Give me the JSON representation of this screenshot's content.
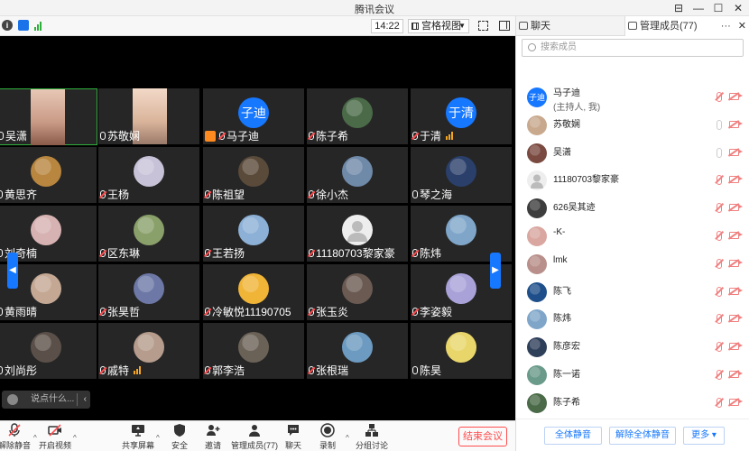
{
  "app": {
    "title": "腾讯会议"
  },
  "window_controls": {
    "pin": "⊟",
    "minimize": "—",
    "maximize": "☐",
    "close": "✕"
  },
  "toolbar": {
    "time": "14:22",
    "view": "宫格视图"
  },
  "tiles": [
    {
      "name": "吴潇",
      "avatar": "photo",
      "muted": false,
      "active": true
    },
    {
      "name": "苏敬娴",
      "avatar": "photo",
      "muted": false
    },
    {
      "name": "马子迪",
      "avatar": "text",
      "avatar_text": "子迪",
      "muted": true,
      "host": true
    },
    {
      "name": "陈子希",
      "avatar": "img",
      "color": "#4a6a48",
      "muted": true
    },
    {
      "name": "于清",
      "avatar": "text",
      "avatar_text": "于清",
      "muted": true,
      "signal": true
    },
    {
      "name": "黄思齐",
      "avatar": "img",
      "color": "#b8863f",
      "muted": false
    },
    {
      "name": "王杨",
      "avatar": "img",
      "color": "#c8c2d8",
      "muted": true
    },
    {
      "name": "陈祖望",
      "avatar": "img",
      "color": "#5a4a3a",
      "muted": true
    },
    {
      "name": "徐小杰",
      "avatar": "img",
      "color": "#6f89a8",
      "muted": true
    },
    {
      "name": "琴之海",
      "avatar": "img",
      "color": "#2a3f6a",
      "muted": false
    },
    {
      "name": "刘奇楠",
      "avatar": "img",
      "color": "#d7b2b2",
      "muted": false
    },
    {
      "name": "区东琳",
      "avatar": "img",
      "color": "#8aa06a",
      "muted": true
    },
    {
      "name": "王若扬",
      "avatar": "img",
      "color": "#8cb0d6",
      "muted": true
    },
    {
      "name": "11180703黎家豪",
      "avatar": "gray",
      "muted": true
    },
    {
      "name": "陈炜",
      "avatar": "img",
      "color": "#7fa6c9",
      "muted": true
    },
    {
      "name": "黄雨晴",
      "avatar": "img",
      "color": "#c4a894",
      "muted": false
    },
    {
      "name": "张昊哲",
      "avatar": "img",
      "color": "#6d78a6",
      "muted": true
    },
    {
      "name": "冷敏悦11190705",
      "avatar": "img",
      "color": "#f0b437",
      "muted": true
    },
    {
      "name": "张玉炎",
      "avatar": "img",
      "color": "#6a5a52",
      "muted": true
    },
    {
      "name": "李姿毅",
      "avatar": "img",
      "color": "#a9a2d8",
      "muted": true
    },
    {
      "name": "刘尚彤",
      "avatar": "img",
      "color": "#5b5049",
      "muted": false
    },
    {
      "name": "戚特",
      "avatar": "img",
      "color": "#b59c8c",
      "muted": true,
      "signal": true
    },
    {
      "name": "郭李浩",
      "avatar": "img",
      "color": "#6b6257",
      "muted": true
    },
    {
      "name": "张根瑞",
      "avatar": "img",
      "color": "#6c9ac0",
      "muted": true
    },
    {
      "name": "陈昊",
      "avatar": "img",
      "color": "#e9d66b",
      "muted": false
    }
  ],
  "chat_input": {
    "placeholder": "说点什么..."
  },
  "bottombar": {
    "unmute": "解除静音",
    "video": "开启视频",
    "share": "共享屏幕",
    "security": "安全",
    "invite": "邀请",
    "members": "管理成员(77)",
    "chat": "聊天",
    "record": "录制",
    "breakout": "分组讨论",
    "end": "结束会议"
  },
  "panel": {
    "tab_chat": "聊天",
    "tab_members": "管理成员(77)",
    "more": "···",
    "close": "✕",
    "search_placeholder": "搜索成员",
    "members": [
      {
        "name": "马子迪",
        "sub": "(主持人, 我)",
        "avatar": "text",
        "avatar_text": "子迪",
        "mic_muted": true,
        "cam_off": true
      },
      {
        "name": "苏敬娴",
        "avatar": "img",
        "color": "#c8a98e",
        "mic_muted": false,
        "cam_off": true
      },
      {
        "name": "吴潇",
        "avatar": "img",
        "color": "#7a4a40",
        "mic_muted": false,
        "cam_off": true
      },
      {
        "name": "11180703黎家豪",
        "avatar": "gray",
        "mic_muted": true,
        "cam_off": true
      },
      {
        "name": "626吴其迹",
        "avatar": "img",
        "color": "#3d3d3d",
        "mic_muted": true,
        "cam_off": true
      },
      {
        "name": "-K-",
        "avatar": "img",
        "color": "#d9a7a0",
        "mic_muted": true,
        "cam_off": true
      },
      {
        "name": "lmk",
        "avatar": "img",
        "color": "#b88f8a",
        "mic_muted": true,
        "cam_off": true
      },
      {
        "name": "陈飞",
        "avatar": "img",
        "color": "#1f4f8a",
        "mic_muted": true,
        "cam_off": true
      },
      {
        "name": "陈炜",
        "avatar": "img",
        "color": "#7fa6c9",
        "mic_muted": true,
        "cam_off": true
      },
      {
        "name": "陈彦宏",
        "avatar": "img",
        "color": "#2e3f5a",
        "mic_muted": true,
        "cam_off": true
      },
      {
        "name": "陈一诺",
        "avatar": "img",
        "color": "#6a9a8a",
        "mic_muted": true,
        "cam_off": true
      },
      {
        "name": "陈子希",
        "avatar": "img",
        "color": "#4a6a48",
        "mic_muted": true,
        "cam_off": true
      }
    ],
    "mute_all": "全体静音",
    "unmute_all": "解除全体静音",
    "more_btn": "更多 ▾"
  }
}
